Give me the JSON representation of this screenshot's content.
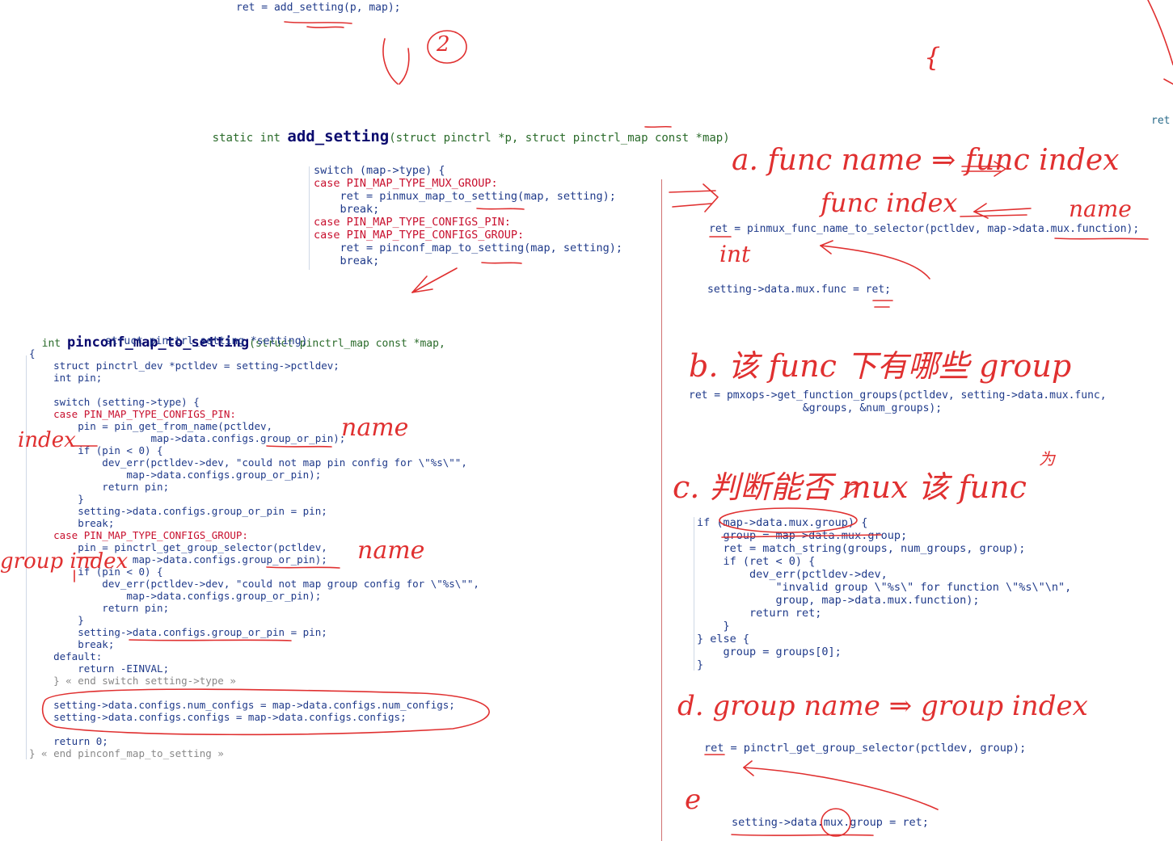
{
  "code_top": {
    "call": "ret = add_setting(p, map);",
    "ret_right": "ret"
  },
  "signature": {
    "prefix": "static int ",
    "name": "add_setting",
    "params": "(struct pinctrl *p, struct pinctrl_map const *map)"
  },
  "switch_block": [
    "switch (map->type) {",
    "case PIN_MAP_TYPE_MUX_GROUP:",
    "    ret = pinmux_map_to_setting(map, setting);",
    "    break;",
    "case PIN_MAP_TYPE_CONFIGS_PIN:",
    "case PIN_MAP_TYPE_CONFIGS_GROUP:",
    "    ret = pinconf_map_to_setting(map, setting);",
    "    break;"
  ],
  "pinconf": {
    "sig_prefix": "int ",
    "sig_name": "pinconf_map_to_setting",
    "sig_rest": "(struct pinctrl_map const *map,",
    "sig_line2": "            struct pinctrl_setting *setting)",
    "body": [
      "{",
      "    struct pinctrl_dev *pctldev = setting->pctldev;",
      "    int pin;",
      "",
      "    switch (setting->type) {",
      "    case PIN_MAP_TYPE_CONFIGS_PIN:",
      "        pin = pin_get_from_name(pctldev,",
      "                    map->data.configs.group_or_pin);",
      "        if (pin < 0) {",
      "            dev_err(pctldev->dev, \"could not map pin config for \\\"%s\\\"\",",
      "                map->data.configs.group_or_pin);",
      "            return pin;",
      "        }",
      "        setting->data.configs.group_or_pin = pin;",
      "        break;",
      "    case PIN_MAP_TYPE_CONFIGS_GROUP:",
      "        pin = pinctrl_get_group_selector(pctldev,",
      "                 map->data.configs.group_or_pin);",
      "        if (pin < 0) {",
      "            dev_err(pctldev->dev, \"could not map group config for \\\"%s\\\"\",",
      "                map->data.configs.group_or_pin);",
      "            return pin;",
      "        }",
      "        setting->data.configs.group_or_pin = pin;",
      "        break;",
      "    default:",
      "        return -EINVAL;",
      "    } « end switch setting->type »",
      "",
      "    setting->data.configs.num_configs = map->data.configs.num_configs;",
      "    setting->data.configs.configs = map->data.configs.configs;",
      "",
      "    return 0;",
      "} « end pinconf_map_to_setting »"
    ]
  },
  "right": {
    "a_code": "ret = pinmux_func_name_to_selector(pctldev, map->data.mux.function);",
    "a_code2": "setting->data.mux.func = ret;",
    "b_code1": "ret = pmxops->get_function_groups(pctldev, setting->data.mux.func,",
    "b_code2": "                  &groups, &num_groups);",
    "c_code": [
      "if (map->data.mux.group) {",
      "    group = map->data.mux.group;",
      "    ret = match_string(groups, num_groups, group);",
      "    if (ret < 0) {",
      "        dev_err(pctldev->dev,",
      "            \"invalid group \\\"%s\\\" for function \\\"%s\\\"\\n\",",
      "            group, map->data.mux.function);",
      "        return ret;",
      "    }",
      "} else {",
      "    group = groups[0];",
      "}"
    ],
    "d_code": "ret = pinctrl_get_group_selector(pctldev, group);",
    "e_code": "setting->data.mux.group = ret;"
  },
  "handwriting": {
    "step2": "2",
    "a_title": "a. func name ⇒ func index",
    "a_index": "func index",
    "a_name": "name",
    "a_int": "int",
    "b_title": "b. 该 func 下有哪些 group",
    "c_title": "c. 判断能否 mux 该 func",
    "c_wei": "为",
    "d_title": "d. group name ⇒ group index",
    "e_label": "e",
    "left_index": "index",
    "left_name1": "name",
    "left_name2": "name",
    "left_group_index": "group index",
    "brace": "{"
  }
}
